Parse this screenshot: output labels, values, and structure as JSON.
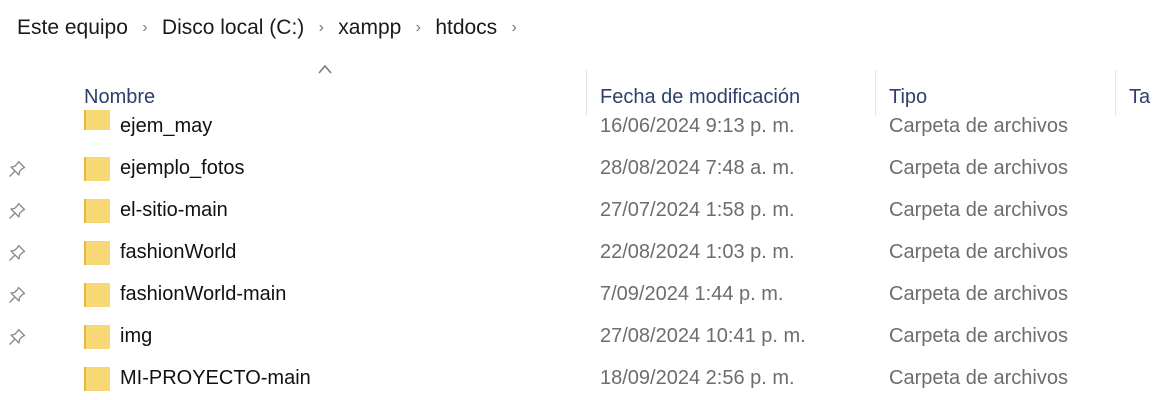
{
  "breadcrumb": {
    "items": [
      "Este equipo",
      "Disco local (C:)",
      "xampp",
      "htdocs"
    ],
    "separator": "›"
  },
  "columns": {
    "name": "Nombre",
    "date": "Fecha de modificación",
    "type": "Tipo",
    "size": "Ta"
  },
  "sort": {
    "column": "name",
    "direction": "ascending",
    "icon": "caret-up-icon"
  },
  "files": [
    {
      "name": "ejem_may",
      "date": "16/06/2024 9:13 p. m.",
      "type": "Carpeta de archivos",
      "pinned": false
    },
    {
      "name": "ejemplo_fotos",
      "date": "28/08/2024 7:48 a. m.",
      "type": "Carpeta de archivos",
      "pinned": true
    },
    {
      "name": "el-sitio-main",
      "date": "27/07/2024 1:58 p. m.",
      "type": "Carpeta de archivos",
      "pinned": true
    },
    {
      "name": "fashionWorld",
      "date": "22/08/2024 1:03 p. m.",
      "type": "Carpeta de archivos",
      "pinned": true
    },
    {
      "name": "fashionWorld-main",
      "date": "7/09/2024 1:44 p. m.",
      "type": "Carpeta de archivos",
      "pinned": true
    },
    {
      "name": "img",
      "date": "27/08/2024 10:41 p. m.",
      "type": "Carpeta de archivos",
      "pinned": true
    },
    {
      "name": "MI-PROYECTO-main",
      "date": "18/09/2024 2:56 p. m.",
      "type": "Carpeta de archivos",
      "pinned": false
    }
  ],
  "colors": {
    "folder": "#f8d775",
    "folder_dark": "#e6b740",
    "header_text": "#2f3f6a",
    "secondary_text": "#6d6d6d"
  }
}
